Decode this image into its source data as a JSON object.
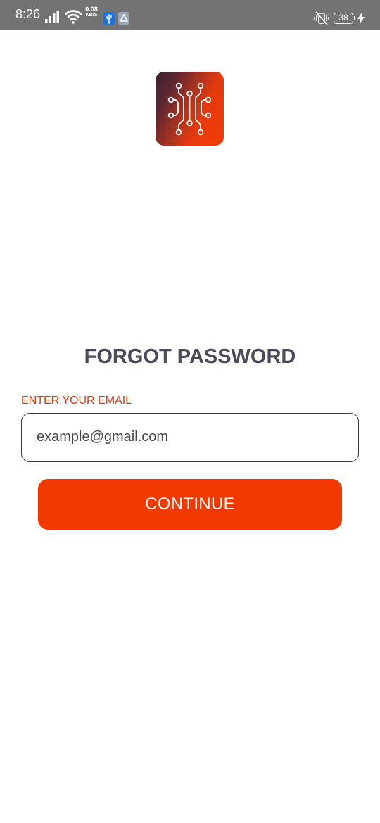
{
  "status_bar": {
    "time": "8:26",
    "network_speed_value": "0.08",
    "network_speed_unit": "KB/S",
    "battery_level": "38",
    "icons": [
      "signal-icon",
      "wifi-icon",
      "usb-icon",
      "drive-icon",
      "vibrate-icon",
      "battery-icon",
      "charging-icon"
    ]
  },
  "app": {
    "logo_icon": "circuit-logo-icon",
    "brand_colors": {
      "accent": "#f23a00",
      "label": "#d83b0d",
      "title": "#4d4a59"
    }
  },
  "forgot": {
    "title": "FORGOT PASSWORD",
    "email_label": "ENTER YOUR EMAIL",
    "email_placeholder": "example@gmail.com",
    "email_value": "",
    "continue_label": "CONTINUE"
  }
}
